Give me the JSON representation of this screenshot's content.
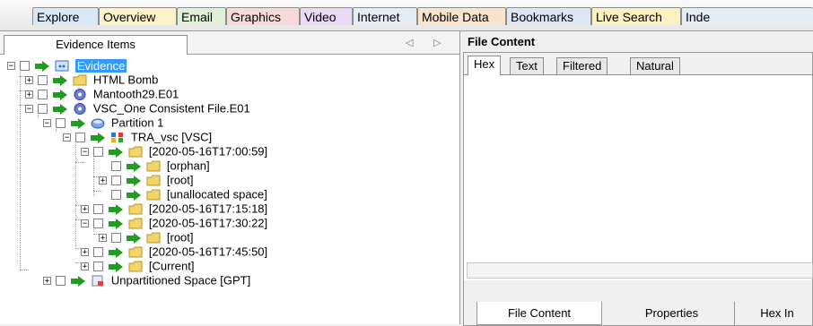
{
  "top_tabs": [
    {
      "label": "Explore",
      "bg": "#d9e8f7"
    },
    {
      "label": "Overview",
      "bg": "#fbf4c8"
    },
    {
      "label": "Email",
      "bg": "#e0f0d6"
    },
    {
      "label": "Graphics",
      "bg": "#f7d9d9"
    },
    {
      "label": "Video",
      "bg": "#ead9f5"
    },
    {
      "label": "Internet",
      "bg": "#e6ecf4"
    },
    {
      "label": "Mobile Data",
      "bg": "#f8e4cc"
    },
    {
      "label": "Bookmarks",
      "bg": "#dce6f5"
    },
    {
      "label": "Live Search",
      "bg": "#fbf1c0"
    },
    {
      "label": "Inde",
      "bg": "#e6ecf4"
    }
  ],
  "left_pane": {
    "tab_label": "Evidence Items",
    "nav_prev": "◁",
    "nav_next": "▷"
  },
  "tree": [
    {
      "label": "Evidence",
      "icon": "evidence-icon",
      "selected": true
    },
    {
      "label": "HTML Bomb",
      "icon": "folder-icon"
    },
    {
      "label": "Mantooth29.E01",
      "icon": "disk-image-icon"
    },
    {
      "label": "VSC_One Consistent File.E01",
      "icon": "disk-image-icon"
    },
    {
      "label": "Partition 1",
      "icon": "partition-icon"
    },
    {
      "label": "TRA_vsc [VSC]",
      "icon": "vsc-icon"
    },
    {
      "label": "[2020-05-16T17:00:59]",
      "icon": "folder-icon"
    },
    {
      "label": "[orphan]",
      "icon": "folder-icon"
    },
    {
      "label": "[root]",
      "icon": "folder-icon"
    },
    {
      "label": "[unallocated space]",
      "icon": "folder-icon"
    },
    {
      "label": "[2020-05-16T17:15:18]",
      "icon": "folder-icon"
    },
    {
      "label": "[2020-05-16T17:30:22]",
      "icon": "folder-icon"
    },
    {
      "label": "[root]",
      "icon": "folder-icon"
    },
    {
      "label": "[2020-05-16T17:45:50]",
      "icon": "folder-icon"
    },
    {
      "label": "[Current]",
      "icon": "folder-icon"
    },
    {
      "label": "Unpartitioned Space [GPT]",
      "icon": "unpartitioned-icon"
    }
  ],
  "right_pane": {
    "title": "File Content",
    "content_tabs": [
      "Hex",
      "Text",
      "Filtered",
      "Natural"
    ],
    "active_content_tab": "Hex",
    "bottom_tabs": [
      "File Content",
      "Properties",
      "Hex In"
    ]
  },
  "colors": {
    "selection": "#3399ff",
    "flag_green": "#1e9e1e",
    "folder": "#f2d46b"
  }
}
